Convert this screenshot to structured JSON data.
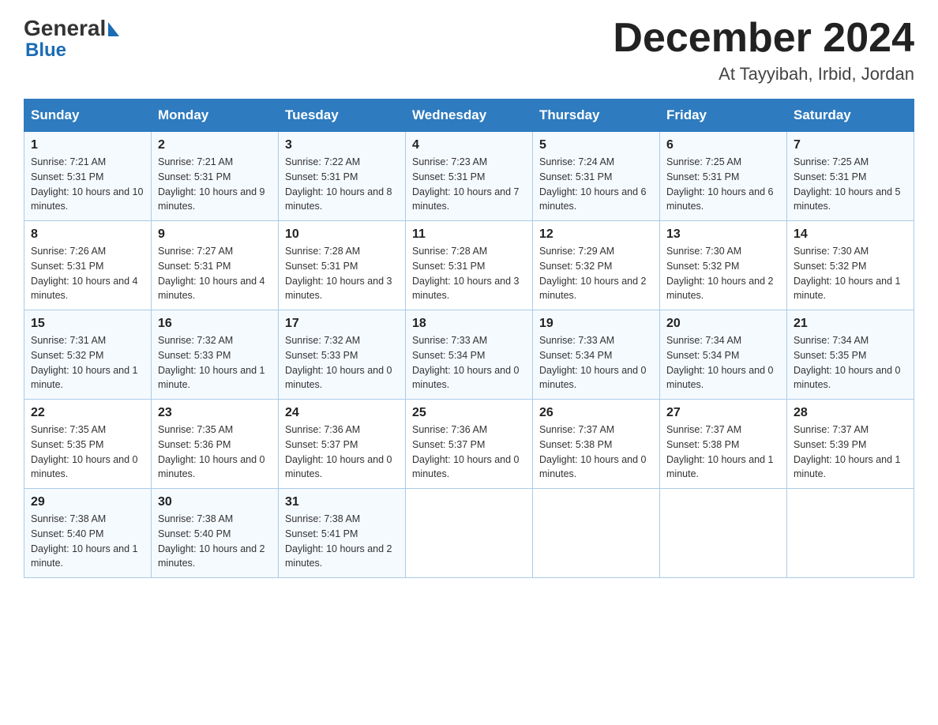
{
  "header": {
    "logo_general": "General",
    "logo_blue": "Blue",
    "month_year": "December 2024",
    "location": "At Tayyibah, Irbid, Jordan"
  },
  "days_of_week": [
    "Sunday",
    "Monday",
    "Tuesday",
    "Wednesday",
    "Thursday",
    "Friday",
    "Saturday"
  ],
  "weeks": [
    [
      {
        "day": "1",
        "sunrise": "Sunrise: 7:21 AM",
        "sunset": "Sunset: 5:31 PM",
        "daylight": "Daylight: 10 hours and 10 minutes."
      },
      {
        "day": "2",
        "sunrise": "Sunrise: 7:21 AM",
        "sunset": "Sunset: 5:31 PM",
        "daylight": "Daylight: 10 hours and 9 minutes."
      },
      {
        "day": "3",
        "sunrise": "Sunrise: 7:22 AM",
        "sunset": "Sunset: 5:31 PM",
        "daylight": "Daylight: 10 hours and 8 minutes."
      },
      {
        "day": "4",
        "sunrise": "Sunrise: 7:23 AM",
        "sunset": "Sunset: 5:31 PM",
        "daylight": "Daylight: 10 hours and 7 minutes."
      },
      {
        "day": "5",
        "sunrise": "Sunrise: 7:24 AM",
        "sunset": "Sunset: 5:31 PM",
        "daylight": "Daylight: 10 hours and 6 minutes."
      },
      {
        "day": "6",
        "sunrise": "Sunrise: 7:25 AM",
        "sunset": "Sunset: 5:31 PM",
        "daylight": "Daylight: 10 hours and 6 minutes."
      },
      {
        "day": "7",
        "sunrise": "Sunrise: 7:25 AM",
        "sunset": "Sunset: 5:31 PM",
        "daylight": "Daylight: 10 hours and 5 minutes."
      }
    ],
    [
      {
        "day": "8",
        "sunrise": "Sunrise: 7:26 AM",
        "sunset": "Sunset: 5:31 PM",
        "daylight": "Daylight: 10 hours and 4 minutes."
      },
      {
        "day": "9",
        "sunrise": "Sunrise: 7:27 AM",
        "sunset": "Sunset: 5:31 PM",
        "daylight": "Daylight: 10 hours and 4 minutes."
      },
      {
        "day": "10",
        "sunrise": "Sunrise: 7:28 AM",
        "sunset": "Sunset: 5:31 PM",
        "daylight": "Daylight: 10 hours and 3 minutes."
      },
      {
        "day": "11",
        "sunrise": "Sunrise: 7:28 AM",
        "sunset": "Sunset: 5:31 PM",
        "daylight": "Daylight: 10 hours and 3 minutes."
      },
      {
        "day": "12",
        "sunrise": "Sunrise: 7:29 AM",
        "sunset": "Sunset: 5:32 PM",
        "daylight": "Daylight: 10 hours and 2 minutes."
      },
      {
        "day": "13",
        "sunrise": "Sunrise: 7:30 AM",
        "sunset": "Sunset: 5:32 PM",
        "daylight": "Daylight: 10 hours and 2 minutes."
      },
      {
        "day": "14",
        "sunrise": "Sunrise: 7:30 AM",
        "sunset": "Sunset: 5:32 PM",
        "daylight": "Daylight: 10 hours and 1 minute."
      }
    ],
    [
      {
        "day": "15",
        "sunrise": "Sunrise: 7:31 AM",
        "sunset": "Sunset: 5:32 PM",
        "daylight": "Daylight: 10 hours and 1 minute."
      },
      {
        "day": "16",
        "sunrise": "Sunrise: 7:32 AM",
        "sunset": "Sunset: 5:33 PM",
        "daylight": "Daylight: 10 hours and 1 minute."
      },
      {
        "day": "17",
        "sunrise": "Sunrise: 7:32 AM",
        "sunset": "Sunset: 5:33 PM",
        "daylight": "Daylight: 10 hours and 0 minutes."
      },
      {
        "day": "18",
        "sunrise": "Sunrise: 7:33 AM",
        "sunset": "Sunset: 5:34 PM",
        "daylight": "Daylight: 10 hours and 0 minutes."
      },
      {
        "day": "19",
        "sunrise": "Sunrise: 7:33 AM",
        "sunset": "Sunset: 5:34 PM",
        "daylight": "Daylight: 10 hours and 0 minutes."
      },
      {
        "day": "20",
        "sunrise": "Sunrise: 7:34 AM",
        "sunset": "Sunset: 5:34 PM",
        "daylight": "Daylight: 10 hours and 0 minutes."
      },
      {
        "day": "21",
        "sunrise": "Sunrise: 7:34 AM",
        "sunset": "Sunset: 5:35 PM",
        "daylight": "Daylight: 10 hours and 0 minutes."
      }
    ],
    [
      {
        "day": "22",
        "sunrise": "Sunrise: 7:35 AM",
        "sunset": "Sunset: 5:35 PM",
        "daylight": "Daylight: 10 hours and 0 minutes."
      },
      {
        "day": "23",
        "sunrise": "Sunrise: 7:35 AM",
        "sunset": "Sunset: 5:36 PM",
        "daylight": "Daylight: 10 hours and 0 minutes."
      },
      {
        "day": "24",
        "sunrise": "Sunrise: 7:36 AM",
        "sunset": "Sunset: 5:37 PM",
        "daylight": "Daylight: 10 hours and 0 minutes."
      },
      {
        "day": "25",
        "sunrise": "Sunrise: 7:36 AM",
        "sunset": "Sunset: 5:37 PM",
        "daylight": "Daylight: 10 hours and 0 minutes."
      },
      {
        "day": "26",
        "sunrise": "Sunrise: 7:37 AM",
        "sunset": "Sunset: 5:38 PM",
        "daylight": "Daylight: 10 hours and 0 minutes."
      },
      {
        "day": "27",
        "sunrise": "Sunrise: 7:37 AM",
        "sunset": "Sunset: 5:38 PM",
        "daylight": "Daylight: 10 hours and 1 minute."
      },
      {
        "day": "28",
        "sunrise": "Sunrise: 7:37 AM",
        "sunset": "Sunset: 5:39 PM",
        "daylight": "Daylight: 10 hours and 1 minute."
      }
    ],
    [
      {
        "day": "29",
        "sunrise": "Sunrise: 7:38 AM",
        "sunset": "Sunset: 5:40 PM",
        "daylight": "Daylight: 10 hours and 1 minute."
      },
      {
        "day": "30",
        "sunrise": "Sunrise: 7:38 AM",
        "sunset": "Sunset: 5:40 PM",
        "daylight": "Daylight: 10 hours and 2 minutes."
      },
      {
        "day": "31",
        "sunrise": "Sunrise: 7:38 AM",
        "sunset": "Sunset: 5:41 PM",
        "daylight": "Daylight: 10 hours and 2 minutes."
      },
      null,
      null,
      null,
      null
    ]
  ]
}
